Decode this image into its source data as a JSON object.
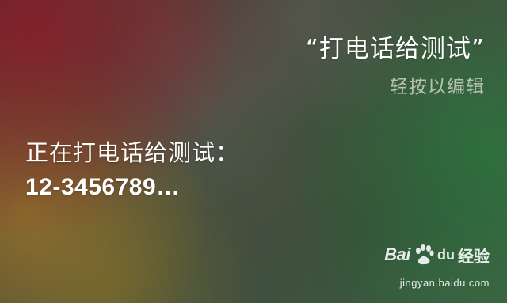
{
  "siri": {
    "query": "“打电话给测试”",
    "tap_to_edit": "轻按以编辑",
    "response_line1": "正在打电话给测试：",
    "response_line2": "12-3456789…"
  },
  "watermark": {
    "brand_bai": "Bai",
    "brand_du": "du",
    "brand_jingyan": "经验",
    "url": "jingyan.baidu.com"
  },
  "colors": {
    "text_primary": "#ffffff",
    "text_secondary": "#d8d8d2"
  }
}
